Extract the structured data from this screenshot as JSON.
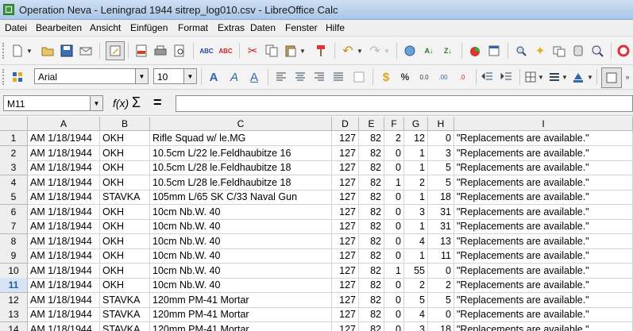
{
  "window": {
    "title": "Operation Neva - Leningrad 1944 sitrep_log010.csv - LibreOffice Calc"
  },
  "menu": [
    "Datei",
    "Bearbeiten",
    "Ansicht",
    "Einfügen",
    "Format",
    "Extras",
    "Daten",
    "Fenster",
    "Hilfe"
  ],
  "format_toolbar": {
    "font_name": "Arial",
    "font_size": "10"
  },
  "formula_bar": {
    "cell_ref": "M11",
    "fx": "f(x)",
    "sigma": "Σ",
    "equals": "=",
    "content": ""
  },
  "colors": {
    "selected_header": "#d8e4f3",
    "header": "#eeeeee",
    "grid_line": "#d4d4d4"
  },
  "sheet": {
    "columns": [
      "A",
      "B",
      "C",
      "D",
      "E",
      "F",
      "G",
      "H",
      "I"
    ],
    "selected_row": 11,
    "rows": [
      {
        "n": "1",
        "cells": [
          "AM 1/18/1944",
          "OKH",
          "Rifle Squad w/ le.MG",
          "127",
          "82",
          "2",
          "12",
          "0",
          "\"Replacements are available.\""
        ]
      },
      {
        "n": "2",
        "cells": [
          "AM 1/18/1944",
          "OKH",
          "10.5cm L/22 le.Feldhaubitze 16",
          "127",
          "82",
          "0",
          "1",
          "3",
          "\"Replacements are available.\""
        ]
      },
      {
        "n": "3",
        "cells": [
          "AM 1/18/1944",
          "OKH",
          "10.5cm L/28 le.Feldhaubitze 18",
          "127",
          "82",
          "0",
          "1",
          "5",
          "\"Replacements are available.\""
        ]
      },
      {
        "n": "4",
        "cells": [
          "AM 1/18/1944",
          "OKH",
          "10.5cm L/28 le.Feldhaubitze 18",
          "127",
          "82",
          "1",
          "2",
          "5",
          "\"Replacements are available.\""
        ]
      },
      {
        "n": "5",
        "cells": [
          "AM 1/18/1944",
          "STAVKA",
          "105mm L/65 SK C/33 Naval Gun",
          "127",
          "82",
          "0",
          "1",
          "18",
          "\"Replacements are available.\""
        ]
      },
      {
        "n": "6",
        "cells": [
          "AM 1/18/1944",
          "OKH",
          "10cm Nb.W. 40",
          "127",
          "82",
          "0",
          "3",
          "31",
          "\"Replacements are available.\""
        ]
      },
      {
        "n": "7",
        "cells": [
          "AM 1/18/1944",
          "OKH",
          "10cm Nb.W. 40",
          "127",
          "82",
          "0",
          "1",
          "31",
          "\"Replacements are available.\""
        ]
      },
      {
        "n": "8",
        "cells": [
          "AM 1/18/1944",
          "OKH",
          "10cm Nb.W. 40",
          "127",
          "82",
          "0",
          "4",
          "13",
          "\"Replacements are available.\""
        ]
      },
      {
        "n": "9",
        "cells": [
          "AM 1/18/1944",
          "OKH",
          "10cm Nb.W. 40",
          "127",
          "82",
          "0",
          "1",
          "11",
          "\"Replacements are available.\""
        ]
      },
      {
        "n": "10",
        "cells": [
          "AM 1/18/1944",
          "OKH",
          "10cm Nb.W. 40",
          "127",
          "82",
          "1",
          "55",
          "0",
          "\"Replacements are available.\""
        ]
      },
      {
        "n": "11",
        "cells": [
          "AM 1/18/1944",
          "OKH",
          "10cm Nb.W. 40",
          "127",
          "82",
          "0",
          "2",
          "2",
          "\"Replacements are available.\""
        ]
      },
      {
        "n": "12",
        "cells": [
          "AM 1/18/1944",
          "STAVKA",
          "120mm PM-41 Mortar",
          "127",
          "82",
          "0",
          "5",
          "5",
          "\"Replacements are available.\""
        ]
      },
      {
        "n": "13",
        "cells": [
          "AM 1/18/1944",
          "STAVKA",
          "120mm PM-41 Mortar",
          "127",
          "82",
          "0",
          "4",
          "0",
          "\"Replacements are available.\""
        ]
      },
      {
        "n": "14",
        "cells": [
          "AM 1/18/1944",
          "STAVKA",
          "120mm PM-41 Mortar",
          "127",
          "82",
          "0",
          "3",
          "18",
          "\"Replacements are available.\""
        ]
      }
    ]
  }
}
